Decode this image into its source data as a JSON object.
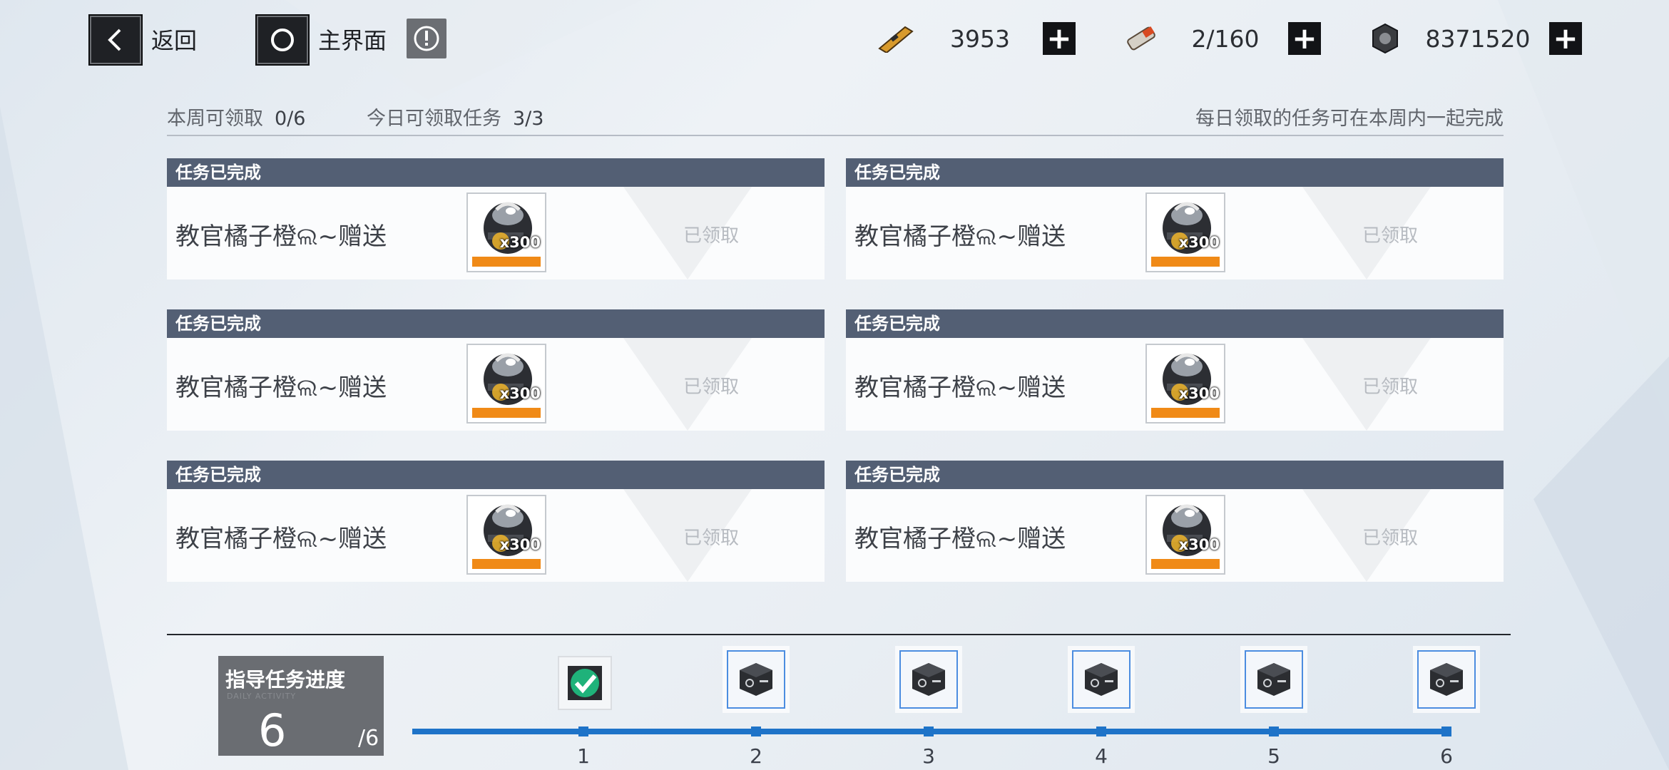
{
  "topbar": {
    "back_label": "返回",
    "home_label": "主界面",
    "icons": {
      "back": "chevron-left-icon",
      "home": "circle-icon",
      "info": "exclamation-circle-icon"
    }
  },
  "resources": [
    {
      "icon": "ticket-icon",
      "value": "3953"
    },
    {
      "icon": "battery-icon",
      "value": "2/160"
    },
    {
      "icon": "gear-coin-icon",
      "value": "8371520"
    }
  ],
  "info": {
    "weekly_label": "本周可领取",
    "weekly_value": "0/6",
    "daily_label": "今日可领取任务",
    "daily_value": "3/3",
    "note": "每日领取的任务可在本周内一起完成"
  },
  "tasks": [
    {
      "status": "任务已完成",
      "name": "教官橘子橙ଲ~赠送",
      "reward_qty": "x300",
      "state": "已领取"
    },
    {
      "status": "任务已完成",
      "name": "教官橘子橙ଲ~赠送",
      "reward_qty": "x300",
      "state": "已领取"
    },
    {
      "status": "任务已完成",
      "name": "教官橘子橙ଲ~赠送",
      "reward_qty": "x300",
      "state": "已领取"
    },
    {
      "status": "任务已完成",
      "name": "教官橘子橙ଲ~赠送",
      "reward_qty": "x300",
      "state": "已领取"
    },
    {
      "status": "任务已完成",
      "name": "教官橘子橙ଲ~赠送",
      "reward_qty": "x300",
      "state": "已领取"
    },
    {
      "status": "任务已完成",
      "name": "教官橘子橙ଲ~赠送",
      "reward_qty": "x300",
      "state": "已领取"
    }
  ],
  "progress": {
    "title": "指导任务进度",
    "subtitle": "DAILY ACTIVITY",
    "current": "6",
    "total": "/6",
    "steps": [
      "1",
      "2",
      "3",
      "4",
      "5",
      "6"
    ],
    "colors": {
      "accent": "#1e73c8",
      "header": "#535f74",
      "reward_bar": "#f08a17"
    }
  }
}
